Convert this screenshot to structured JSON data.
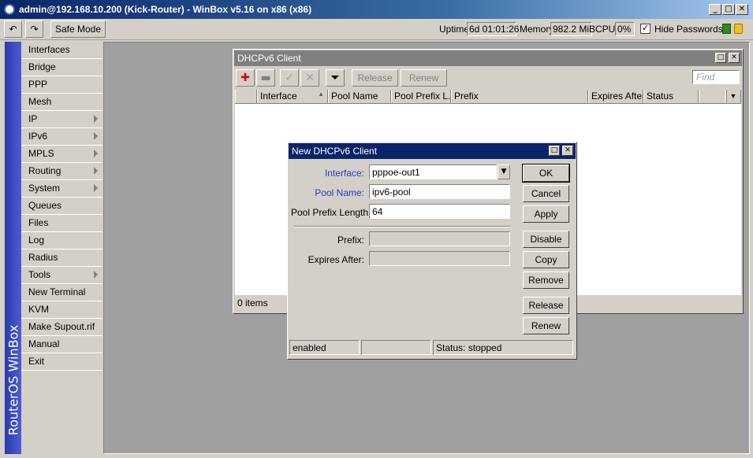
{
  "app": {
    "title": "admin@192.168.10.200 (Kick-Router) - WinBox v5.16 on x86 (x86)",
    "brand": "RouterOS WinBox",
    "accent_color": "#0a246a"
  },
  "toolbar": {
    "undo_icon": "undo-icon",
    "redo_icon": "redo-icon",
    "safe_mode_label": "Safe Mode",
    "uptime_label": "Uptime:",
    "uptime_value": "6d 01:01:26",
    "memory_label": "Memory:",
    "memory_value": "982.2 MiB",
    "cpu_label": "CPU:",
    "cpu_value": "0%",
    "hide_passwords_label": "Hide Passwords",
    "hide_passwords_checked": true,
    "hide_passwords_mark": "✓"
  },
  "sidebar": {
    "items": [
      {
        "label": "Interfaces",
        "submenu": false
      },
      {
        "label": "Bridge",
        "submenu": false
      },
      {
        "label": "PPP",
        "submenu": false
      },
      {
        "label": "Mesh",
        "submenu": false
      },
      {
        "label": "IP",
        "submenu": true
      },
      {
        "label": "IPv6",
        "submenu": true
      },
      {
        "label": "MPLS",
        "submenu": true
      },
      {
        "label": "Routing",
        "submenu": true
      },
      {
        "label": "System",
        "submenu": true
      },
      {
        "label": "Queues",
        "submenu": false
      },
      {
        "label": "Files",
        "submenu": false
      },
      {
        "label": "Log",
        "submenu": false
      },
      {
        "label": "Radius",
        "submenu": false
      },
      {
        "label": "Tools",
        "submenu": true
      },
      {
        "label": "New Terminal",
        "submenu": false
      },
      {
        "label": "KVM",
        "submenu": false
      },
      {
        "label": "Make Supout.rif",
        "submenu": false
      },
      {
        "label": "Manual",
        "submenu": false
      },
      {
        "label": "Exit",
        "submenu": false
      }
    ]
  },
  "dhcp_window": {
    "title": "DHCPv6 Client",
    "release_label": "Release",
    "renew_label": "Renew",
    "find_placeholder": "Find",
    "columns": [
      "Interface",
      "Pool Name",
      "Pool Prefix L...",
      "Prefix",
      "Expires After",
      "Status"
    ],
    "status_text": "0 items"
  },
  "dialog": {
    "title": "New DHCPv6 Client",
    "interface_label": "Interface:",
    "interface_value": "pppoe-out1",
    "pool_name_label": "Pool Name:",
    "pool_name_value": "ipv6-pool",
    "pool_prefix_label": "Pool Prefix Length:",
    "pool_prefix_value": "64",
    "prefix_label": "Prefix:",
    "prefix_value": "",
    "expires_label": "Expires After:",
    "expires_value": "",
    "buttons": {
      "ok": "OK",
      "cancel": "Cancel",
      "apply": "Apply",
      "disable": "Disable",
      "copy": "Copy",
      "remove": "Remove",
      "release": "Release",
      "renew": "Renew"
    },
    "status_enabled": "enabled",
    "status_middle": "",
    "status_text": "Status: stopped"
  }
}
